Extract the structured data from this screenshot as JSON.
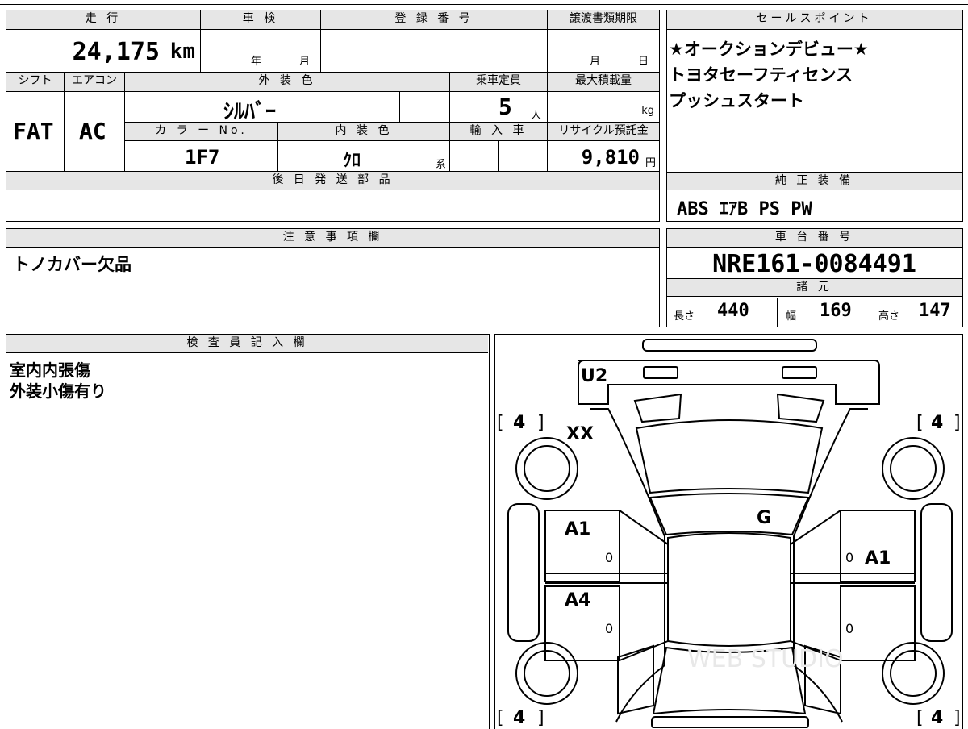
{
  "top_info": {
    "mileage_label": "走 行",
    "mileage_value": "24,175",
    "mileage_unit": "km",
    "inspection_label": "車 検",
    "inspection_year": "年",
    "inspection_month": "月",
    "registration_label": "登 録 番 号",
    "transfer_label": "譲渡書類期限",
    "transfer_month": "月",
    "transfer_day": "日"
  },
  "specs": {
    "shift_label": "シフト",
    "shift_value": "FAT",
    "ac_label": "エアコン",
    "ac_value": "AC",
    "exterior_color_label": "外 装 色",
    "exterior_color_value": "ｼﾙﾊﾞｰ",
    "capacity_label": "乗車定員",
    "capacity_value": "5",
    "capacity_unit": "人",
    "max_load_label": "最大積載量",
    "max_load_unit": "kg",
    "color_no_label": "カ ラ ー No.",
    "color_no_value": "1F7",
    "interior_color_label": "内 装 色",
    "interior_color_value": "ｸﾛ",
    "interior_color_suffix": "系",
    "import_label": "輸 入 車",
    "recycle_label": "リサイクル預託金",
    "recycle_value": "9,810",
    "recycle_unit": "円"
  },
  "later_parts": {
    "label": "後 日 発 送 部 品",
    "value": ""
  },
  "sales_points": {
    "label": "セールスポイント",
    "lines": [
      "★オークションデビュー★",
      "トヨタセーフティセンス",
      "プッシュスタート"
    ]
  },
  "standard_equipment": {
    "label": "純 正 装 備",
    "value": "ABS ｴｱB PS PW"
  },
  "notes": {
    "label": "注 意 事 項 欄",
    "value": "トノカバー欠品"
  },
  "chassis": {
    "label": "車 台 番 号",
    "value": "NRE161-0084491"
  },
  "dimensions": {
    "label": "諸 元",
    "length_label": "長さ",
    "length_value": "440",
    "width_label": "幅",
    "width_value": "169",
    "height_label": "高さ",
    "height_value": "147"
  },
  "inspector": {
    "label": "検 査 員 記 入 欄",
    "lines": [
      "室内内張傷",
      "外装小傷有り"
    ]
  },
  "diagram": {
    "tire_tl": "4",
    "tire_tr": "4",
    "tire_bl": "4",
    "tire_br": "4",
    "bracket_open": "[",
    "bracket_close": "]",
    "mark_rear": "U2",
    "mark_xx": "XX",
    "mark_g": "G",
    "mark_left_front_door": "A1",
    "mark_right_front_door": "A1",
    "mark_left_rear_door": "A4",
    "zero_1": "0",
    "zero_2": "0",
    "zero_3": "0",
    "zero_4": "0",
    "watermark": "WEB STUDIO"
  }
}
